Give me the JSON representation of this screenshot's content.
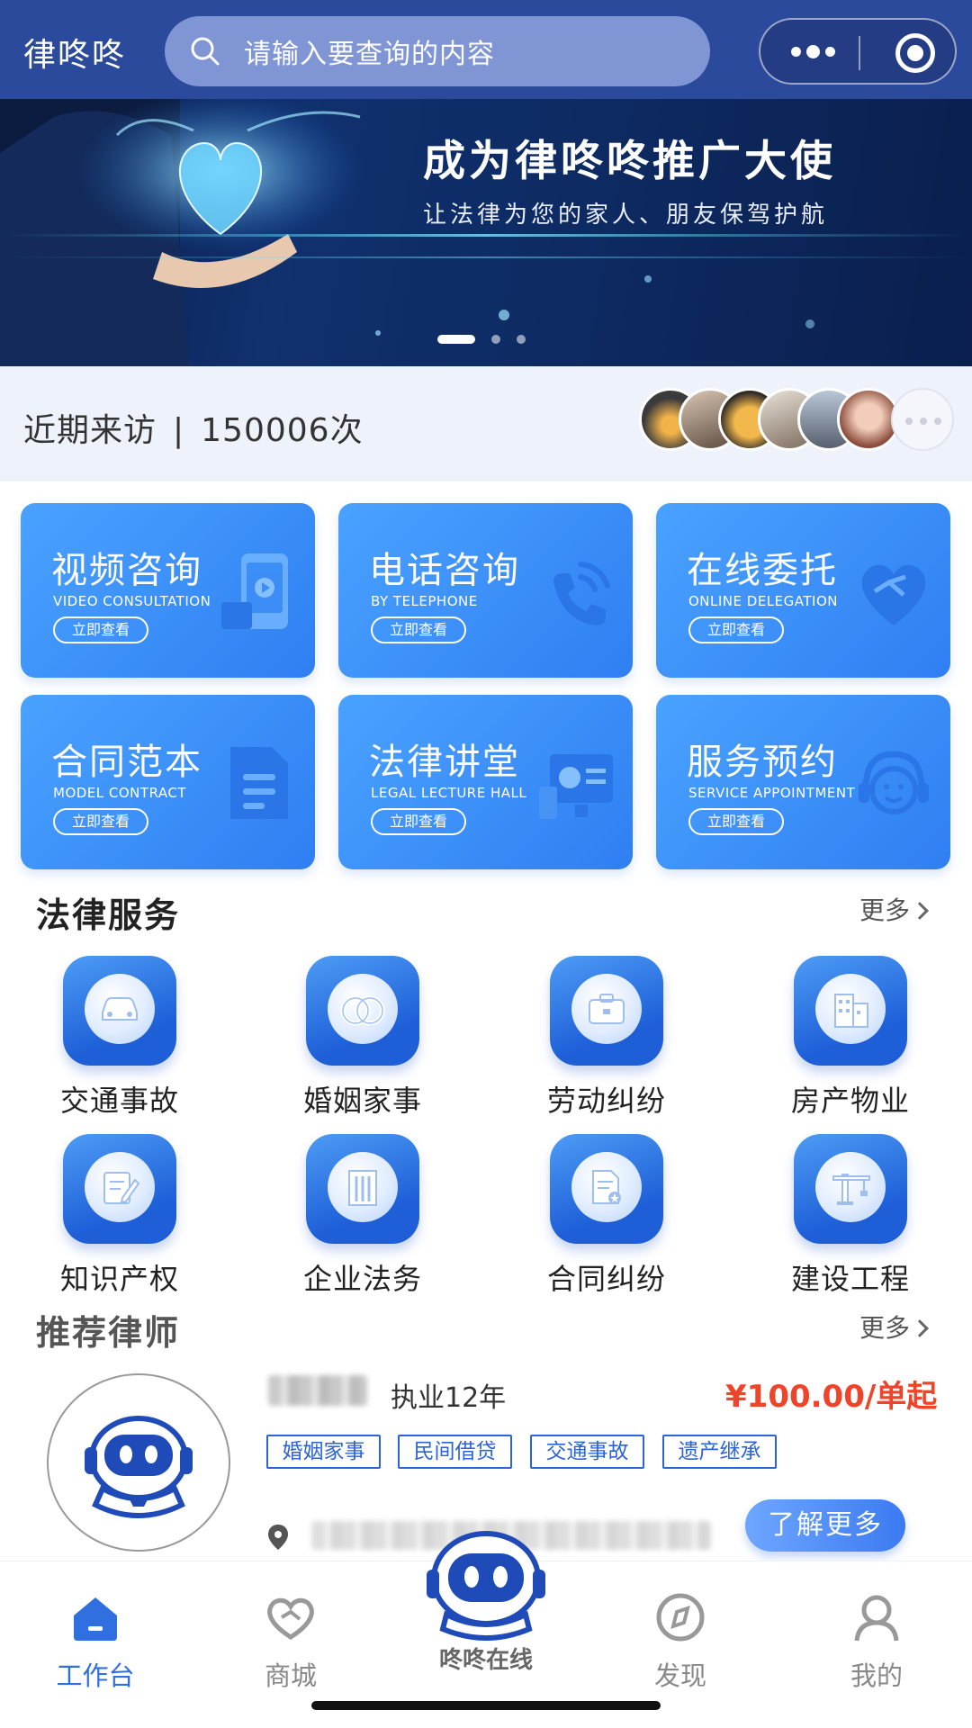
{
  "header": {
    "app_title": "律咚咚",
    "search_placeholder": "请输入要查询的内容"
  },
  "banner": {
    "title": "成为律咚咚推广大使",
    "subtitle": "让法律为您的家人、朋友保驾护航",
    "pages": 3,
    "active_page": 1
  },
  "visits": {
    "label": "近期来访",
    "separator": "|",
    "count": "150006次"
  },
  "consult_cards": [
    {
      "title": "视频咨询",
      "en": "VIDEO CONSULTATION",
      "button": "立即查看",
      "icon": "video-icon"
    },
    {
      "title": "电话咨询",
      "en": "BY TELEPHONE",
      "button": "立即查看",
      "icon": "phone-icon"
    },
    {
      "title": "在线委托",
      "en": "ONLINE DELEGATION",
      "button": "立即查看",
      "icon": "handshake-heart-icon"
    },
    {
      "title": "合同范本",
      "en": "MODEL CONTRACT",
      "button": "立即查看",
      "icon": "document-icon"
    },
    {
      "title": "法律讲堂",
      "en": "LEGAL LECTURE HALL",
      "button": "立即查看",
      "icon": "presentation-icon"
    },
    {
      "title": "服务预约",
      "en": "SERVICE APPOINTMENT",
      "button": "立即查看",
      "icon": "headset-icon"
    }
  ],
  "legal_services": {
    "title": "法律服务",
    "more": "更多",
    "items": [
      {
        "label": "交通事故",
        "icon": "car-icon"
      },
      {
        "label": "婚姻家事",
        "icon": "rings-icon"
      },
      {
        "label": "劳动纠纷",
        "icon": "briefcase-icon"
      },
      {
        "label": "房产物业",
        "icon": "building-icon"
      },
      {
        "label": "知识产权",
        "icon": "edit-document-icon"
      },
      {
        "label": "企业法务",
        "icon": "office-building-icon"
      },
      {
        "label": "合同纠纷",
        "icon": "contract-icon"
      },
      {
        "label": "建设工程",
        "icon": "crane-icon"
      }
    ]
  },
  "recommended_lawyers": {
    "title": "推荐律师",
    "more": "更多",
    "lawyer": {
      "experience": "执业12年",
      "price": "¥100.00/单起",
      "tags": [
        "婚姻家事",
        "民间借贷",
        "交通事故",
        "遗产继承"
      ],
      "more_button": "了解更多"
    }
  },
  "tabbar": {
    "items": [
      {
        "label": "工作台",
        "icon": "home-icon",
        "active": true
      },
      {
        "label": "商城",
        "icon": "heart-shop-icon",
        "active": false
      },
      {
        "label": "咚咚在线",
        "icon": "robot-icon",
        "active": false
      },
      {
        "label": "发现",
        "icon": "compass-icon",
        "active": false
      },
      {
        "label": "我的",
        "icon": "user-icon",
        "active": false
      }
    ]
  },
  "colors": {
    "header_bg": "#2b4a9c",
    "accent": "#2f6fe0",
    "price": "#f0442a",
    "card_blue": "#3b8cf8"
  }
}
